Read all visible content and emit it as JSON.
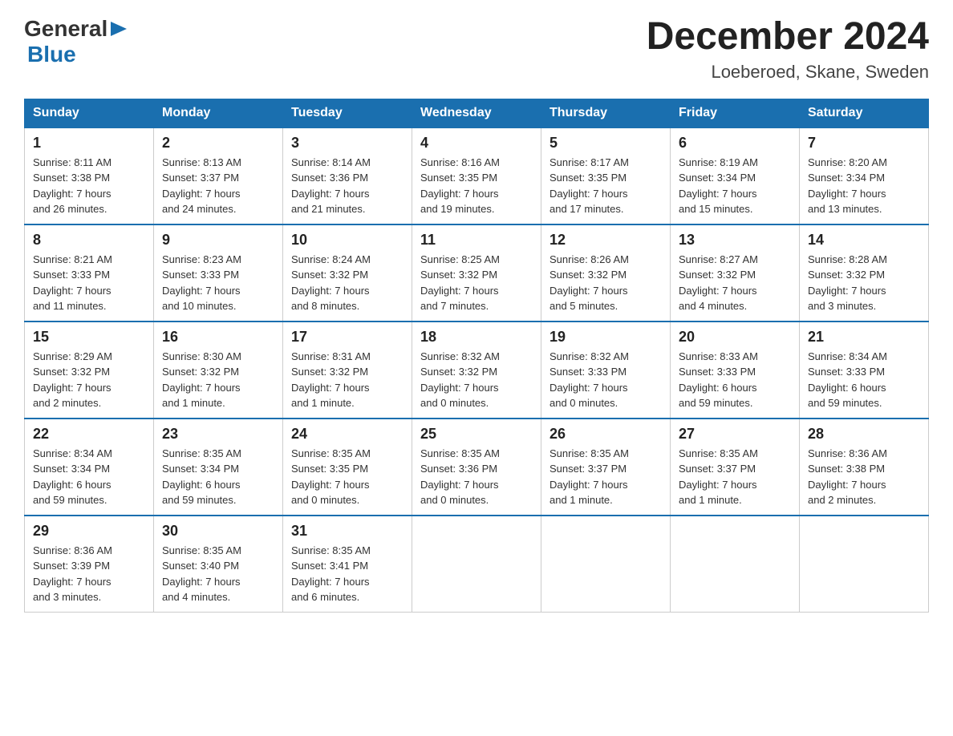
{
  "logo": {
    "general": "General",
    "blue": "Blue"
  },
  "title": "December 2024",
  "subtitle": "Loeberoed, Skane, Sweden",
  "days_of_week": [
    "Sunday",
    "Monday",
    "Tuesday",
    "Wednesday",
    "Thursday",
    "Friday",
    "Saturday"
  ],
  "weeks": [
    [
      {
        "day": "1",
        "info": "Sunrise: 8:11 AM\nSunset: 3:38 PM\nDaylight: 7 hours\nand 26 minutes."
      },
      {
        "day": "2",
        "info": "Sunrise: 8:13 AM\nSunset: 3:37 PM\nDaylight: 7 hours\nand 24 minutes."
      },
      {
        "day": "3",
        "info": "Sunrise: 8:14 AM\nSunset: 3:36 PM\nDaylight: 7 hours\nand 21 minutes."
      },
      {
        "day": "4",
        "info": "Sunrise: 8:16 AM\nSunset: 3:35 PM\nDaylight: 7 hours\nand 19 minutes."
      },
      {
        "day": "5",
        "info": "Sunrise: 8:17 AM\nSunset: 3:35 PM\nDaylight: 7 hours\nand 17 minutes."
      },
      {
        "day": "6",
        "info": "Sunrise: 8:19 AM\nSunset: 3:34 PM\nDaylight: 7 hours\nand 15 minutes."
      },
      {
        "day": "7",
        "info": "Sunrise: 8:20 AM\nSunset: 3:34 PM\nDaylight: 7 hours\nand 13 minutes."
      }
    ],
    [
      {
        "day": "8",
        "info": "Sunrise: 8:21 AM\nSunset: 3:33 PM\nDaylight: 7 hours\nand 11 minutes."
      },
      {
        "day": "9",
        "info": "Sunrise: 8:23 AM\nSunset: 3:33 PM\nDaylight: 7 hours\nand 10 minutes."
      },
      {
        "day": "10",
        "info": "Sunrise: 8:24 AM\nSunset: 3:32 PM\nDaylight: 7 hours\nand 8 minutes."
      },
      {
        "day": "11",
        "info": "Sunrise: 8:25 AM\nSunset: 3:32 PM\nDaylight: 7 hours\nand 7 minutes."
      },
      {
        "day": "12",
        "info": "Sunrise: 8:26 AM\nSunset: 3:32 PM\nDaylight: 7 hours\nand 5 minutes."
      },
      {
        "day": "13",
        "info": "Sunrise: 8:27 AM\nSunset: 3:32 PM\nDaylight: 7 hours\nand 4 minutes."
      },
      {
        "day": "14",
        "info": "Sunrise: 8:28 AM\nSunset: 3:32 PM\nDaylight: 7 hours\nand 3 minutes."
      }
    ],
    [
      {
        "day": "15",
        "info": "Sunrise: 8:29 AM\nSunset: 3:32 PM\nDaylight: 7 hours\nand 2 minutes."
      },
      {
        "day": "16",
        "info": "Sunrise: 8:30 AM\nSunset: 3:32 PM\nDaylight: 7 hours\nand 1 minute."
      },
      {
        "day": "17",
        "info": "Sunrise: 8:31 AM\nSunset: 3:32 PM\nDaylight: 7 hours\nand 1 minute."
      },
      {
        "day": "18",
        "info": "Sunrise: 8:32 AM\nSunset: 3:32 PM\nDaylight: 7 hours\nand 0 minutes."
      },
      {
        "day": "19",
        "info": "Sunrise: 8:32 AM\nSunset: 3:33 PM\nDaylight: 7 hours\nand 0 minutes."
      },
      {
        "day": "20",
        "info": "Sunrise: 8:33 AM\nSunset: 3:33 PM\nDaylight: 6 hours\nand 59 minutes."
      },
      {
        "day": "21",
        "info": "Sunrise: 8:34 AM\nSunset: 3:33 PM\nDaylight: 6 hours\nand 59 minutes."
      }
    ],
    [
      {
        "day": "22",
        "info": "Sunrise: 8:34 AM\nSunset: 3:34 PM\nDaylight: 6 hours\nand 59 minutes."
      },
      {
        "day": "23",
        "info": "Sunrise: 8:35 AM\nSunset: 3:34 PM\nDaylight: 6 hours\nand 59 minutes."
      },
      {
        "day": "24",
        "info": "Sunrise: 8:35 AM\nSunset: 3:35 PM\nDaylight: 7 hours\nand 0 minutes."
      },
      {
        "day": "25",
        "info": "Sunrise: 8:35 AM\nSunset: 3:36 PM\nDaylight: 7 hours\nand 0 minutes."
      },
      {
        "day": "26",
        "info": "Sunrise: 8:35 AM\nSunset: 3:37 PM\nDaylight: 7 hours\nand 1 minute."
      },
      {
        "day": "27",
        "info": "Sunrise: 8:35 AM\nSunset: 3:37 PM\nDaylight: 7 hours\nand 1 minute."
      },
      {
        "day": "28",
        "info": "Sunrise: 8:36 AM\nSunset: 3:38 PM\nDaylight: 7 hours\nand 2 minutes."
      }
    ],
    [
      {
        "day": "29",
        "info": "Sunrise: 8:36 AM\nSunset: 3:39 PM\nDaylight: 7 hours\nand 3 minutes."
      },
      {
        "day": "30",
        "info": "Sunrise: 8:35 AM\nSunset: 3:40 PM\nDaylight: 7 hours\nand 4 minutes."
      },
      {
        "day": "31",
        "info": "Sunrise: 8:35 AM\nSunset: 3:41 PM\nDaylight: 7 hours\nand 6 minutes."
      },
      {
        "day": "",
        "info": ""
      },
      {
        "day": "",
        "info": ""
      },
      {
        "day": "",
        "info": ""
      },
      {
        "day": "",
        "info": ""
      }
    ]
  ]
}
